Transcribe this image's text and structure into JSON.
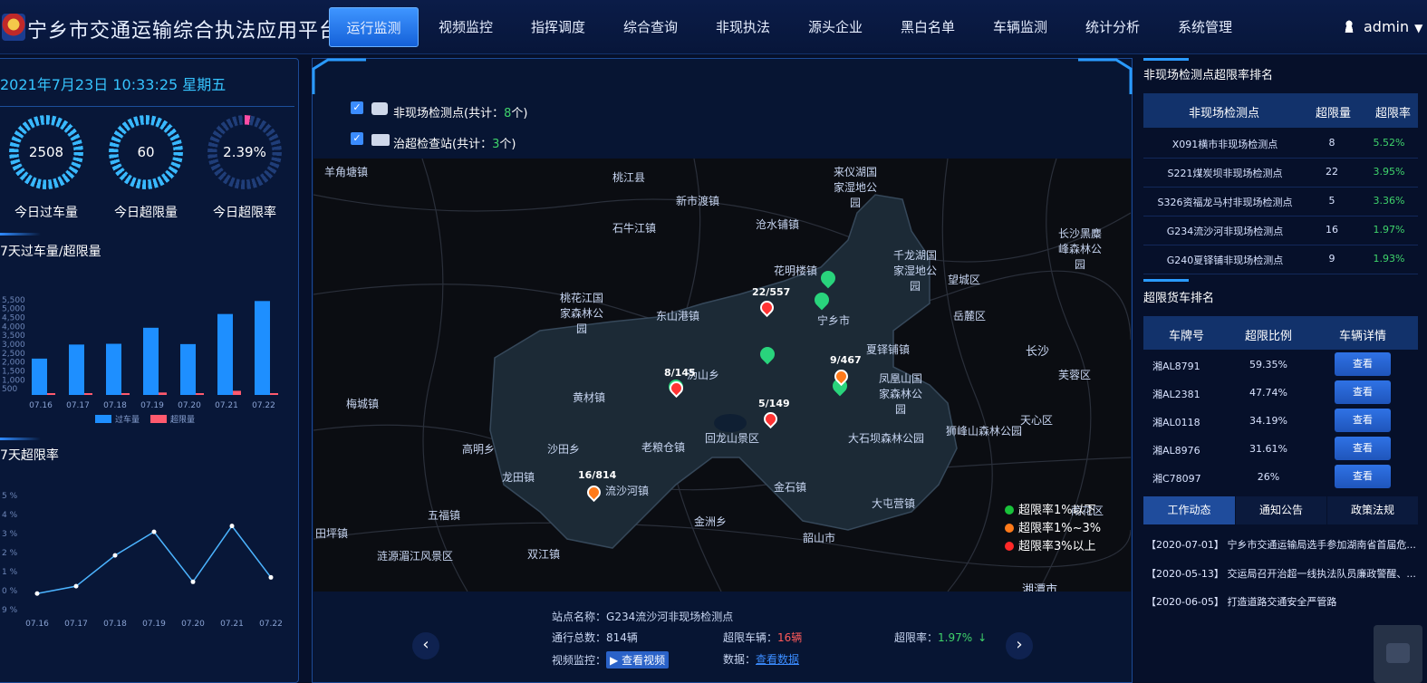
{
  "app": {
    "title": "宁乡市交通运输综合执法应用平台"
  },
  "nav": {
    "items": [
      "运行监测",
      "视频监控",
      "指挥调度",
      "综合查询",
      "非现执法",
      "源头企业",
      "黑白名单",
      "车辆监测",
      "统计分析",
      "系统管理"
    ],
    "active": 0
  },
  "user": {
    "name": "admin"
  },
  "left": {
    "datetime": "2021年7月23日 10:33:25 星期五",
    "stats": [
      {
        "value": "2508",
        "label": "今日过车量"
      },
      {
        "value": "60",
        "label": "今日超限量"
      },
      {
        "value": "2.39%",
        "label": "今日超限率"
      }
    ],
    "chart1_title": "7天过车量/超限量",
    "chart2_title": "7天超限率"
  },
  "chart_data": [
    {
      "type": "bar",
      "title": "7天过车量/超限量",
      "categories": [
        "07.16",
        "07.17",
        "07.18",
        "07.19",
        "07.20",
        "07.21",
        "07.22"
      ],
      "series": [
        {
          "name": "过车量",
          "values": [
            2380,
            3300,
            3350,
            4400,
            3330,
            5300,
            6150
          ]
        },
        {
          "name": "超限量",
          "values": [
            20,
            30,
            40,
            160,
            30,
            270,
            80
          ]
        }
      ],
      "ylim": [
        0,
        7000
      ],
      "ytick_labels": [
        "500",
        "1,000",
        "1,500",
        "2,000",
        "2,500",
        "3,000",
        "3,500",
        "4,000",
        "4,500",
        "5,000",
        "5,500"
      ],
      "legend": "bottom",
      "colors": {
        "过车量": "#1e8fff",
        "超限量": "#ff5a6e"
      }
    },
    {
      "type": "line",
      "title": "7天超限率",
      "categories": [
        "07.16",
        "07.17",
        "07.18",
        "07.19",
        "07.20",
        "07.21",
        "07.22"
      ],
      "series": [
        {
          "values": [
            1.3,
            1.55,
            2.6,
            3.4,
            1.7,
            3.6,
            1.85
          ]
        }
      ],
      "ytick_labels": [
        "5 %",
        "4 %",
        "3 %",
        "2 %",
        "1 %",
        "0 %",
        "9 %"
      ],
      "ylim": [
        1,
        4.7
      ]
    }
  ],
  "map": {
    "checks": [
      {
        "label_pre": "非现场检测点(共计：",
        "count": "8",
        "label_post": "个)"
      },
      {
        "label_pre": "治超检查站(共计：",
        "count": "3",
        "label_post": "个)"
      }
    ],
    "legend": [
      {
        "label": "超限率1%以下",
        "color": "#19c23a"
      },
      {
        "label": "超限率1%~3%",
        "color": "#ff7a1a"
      },
      {
        "label": "超限率3%以上",
        "color": "#ff2828"
      }
    ],
    "place_labels": [
      "桃江县",
      "来仪湖国家湿地公园",
      "新市渡镇",
      "石牛江镇",
      "沧水铺镇",
      "花明楼镇",
      "千龙湖国家湿地公园",
      "长沙黑麋峰森林公园",
      "宁乡市",
      "桃花江国家森林公园",
      "东山港镇",
      "长沙",
      "夏铎铺镇",
      "凤凰山国家森林公园",
      "黄材镇",
      "回龙山景区",
      "大石坝森林公园",
      "老粮仓镇",
      "沩山乡",
      "金石镇",
      "韶山市",
      "湘潭市",
      "天心区",
      "芙蓉区",
      "狮峰山森林公园",
      "大屯营镇",
      "雨花区",
      "岳麓区",
      "望城区",
      "流沙河镇",
      "龙田镇",
      "沙田乡",
      "高明乡",
      "梅城镇",
      "双江镇",
      "涟源湄江风景区",
      "田坪镇",
      "金洲乡",
      "五福镇"
    ],
    "markers": [
      {
        "label": "22/557",
        "color": "#ff3333"
      },
      {
        "label": "8/145",
        "color": "#ff3333"
      },
      {
        "label": "9/467",
        "color": "#ff7a1a"
      },
      {
        "label": "5/149",
        "color": "#ff3333"
      },
      {
        "label": "16/814",
        "color": "#ff7a1a"
      }
    ],
    "info": {
      "name_label": "站点名称：",
      "name": "G234流沙河非现场检测点",
      "total_label": "通行总数：",
      "total": "814辆",
      "over_label": "超限车辆：",
      "over": "16辆",
      "rate_label": "超限率：",
      "rate": "1.97%",
      "video_label": "视频监控：",
      "video_btn": "查看视频",
      "data_label": "数据：",
      "data_link": "查看数据"
    }
  },
  "right": {
    "rank_title": "非现场检测点超限率排名",
    "rank_headers": [
      "非现场检测点",
      "超限量",
      "超限率"
    ],
    "rank_rows": [
      [
        "X091横市非现场检测点",
        "8",
        "5.52%"
      ],
      [
        "S221煤炭坝非现场检测点",
        "22",
        "3.95%"
      ],
      [
        "S326资福龙马村非现场检测点",
        "5",
        "3.36%"
      ],
      [
        "G234流沙河非现场检测点",
        "16",
        "1.97%"
      ],
      [
        "G240夏铎铺非现场检测点",
        "9",
        "1.93%"
      ]
    ],
    "truck_title": "超限货车排名",
    "truck_headers": [
      "车牌号",
      "超限比例",
      "车辆详情"
    ],
    "truck_rows": [
      [
        "湘AL8791",
        "59.35%"
      ],
      [
        "湘AL2381",
        "47.74%"
      ],
      [
        "湘AL0118",
        "34.19%"
      ],
      [
        "湘AL8976",
        "31.61%"
      ],
      [
        "湘C78097",
        "26%"
      ]
    ],
    "view_btn": "查看",
    "tabs": [
      "工作动态",
      "通知公告",
      "政策法规"
    ],
    "news": [
      {
        "date": "【2020-07-01】",
        "text": "宁乡市交通运输局选手参加湖南省首届危..."
      },
      {
        "date": "【2020-05-13】",
        "text": "交运局召开治超一线执法队员廉政警醒、..."
      },
      {
        "date": "【2020-06-05】",
        "text": "打造道路交通安全严管路"
      }
    ]
  }
}
